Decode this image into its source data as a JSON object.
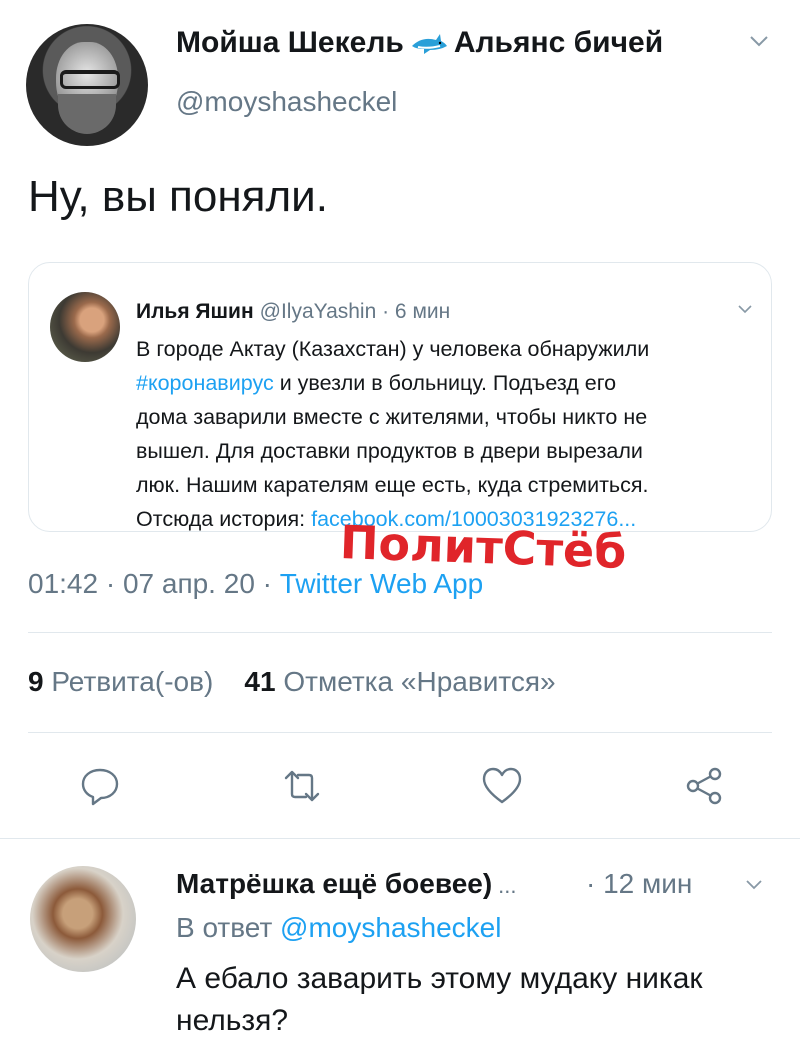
{
  "tweet": {
    "display_name_part1": "Мойша Шекель",
    "display_name_part2": "Альянс бичей",
    "handle": "@moyshasheckel",
    "text": "Ну, вы поняли.",
    "quoted": {
      "name": "Илья Яшин",
      "handle": "@IlyaYashin · 6 мин",
      "line1": "В городе Актау (Казахстан) у человека обнаружили",
      "hashtag": "#коронавирус",
      "line2_rest": " и увезли в больницу. Подъезд его",
      "line3": "дома заварили вместе с жителями, чтобы никто не",
      "line4": "вышел. Для доставки продуктов в двери вырезали",
      "line5": "люк. Нашим карателям еще есть, куда стремиться.",
      "line6_prefix": "Отсюда история: ",
      "line6_link": "facebook.com/10003031923276..."
    },
    "watermark": "ПолитСтёб",
    "meta_time": "01:42 · 07 апр. 20 · ",
    "meta_source": "Twitter Web App",
    "retweets_count": "9",
    "retweets_label": " Ретвита(-ов)",
    "likes_count": "41",
    "likes_label": " Отметка «Нравится»"
  },
  "actions": [
    "reply-icon",
    "retweet-icon",
    "like-icon",
    "share-icon"
  ],
  "reply": {
    "name": "Матрёшка ещё боевее)",
    "ellipsis": "...",
    "time": "· 12 мин",
    "reply_to_prefix": "В ответ ",
    "reply_to_handle": "@moyshasheckel",
    "text": "А ебало заварить этому мудаку никак нельзя?"
  },
  "colors": {
    "link": "#1da1f2",
    "secondary": "#657786",
    "text": "#14171a",
    "divider": "#e1e8ed",
    "watermark": "#e0252a"
  }
}
